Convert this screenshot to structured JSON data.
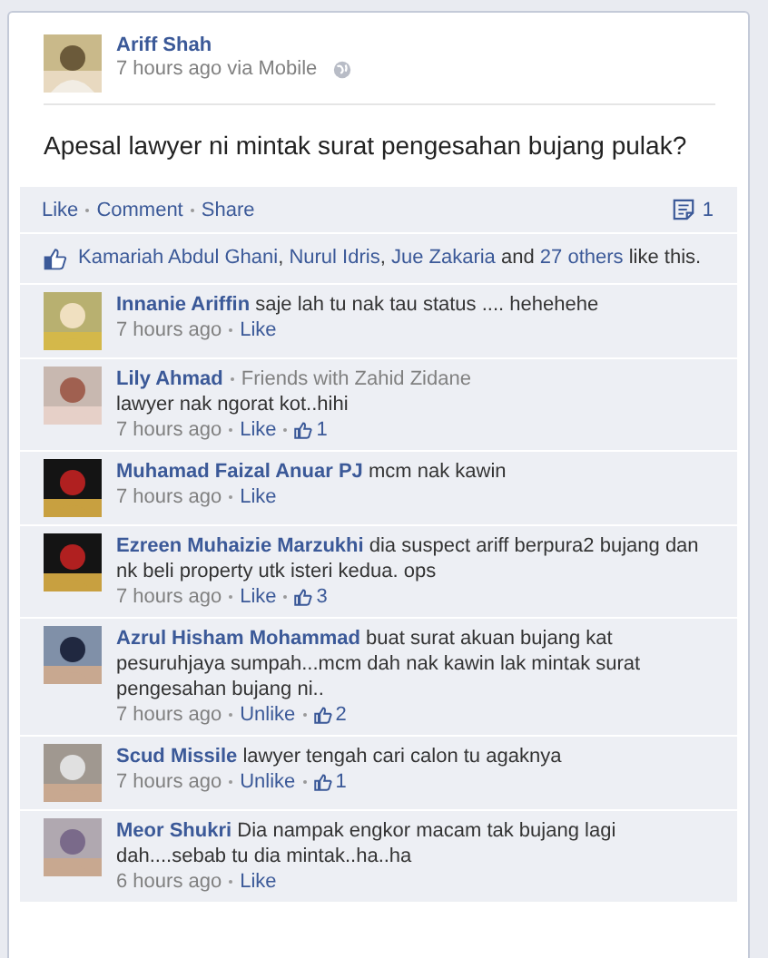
{
  "post": {
    "author": "Ariff Shah",
    "time": "7 hours ago via Mobile",
    "text": "Apesal lawyer ni mintak surat pengesahan bujang pulak?"
  },
  "actions": [
    "Like",
    "Comment",
    "Share"
  ],
  "comment_count": "1",
  "likes": {
    "parts": [
      {
        "text": "Kamariah Abdul Ghani",
        "link": true
      },
      {
        "text": ", ",
        "link": false
      },
      {
        "text": "Nurul Idris",
        "link": true
      },
      {
        "text": ", ",
        "link": false
      },
      {
        "text": "Jue Zakaria",
        "link": true
      },
      {
        "text": " and ",
        "link": false
      },
      {
        "text": "27 others",
        "link": true
      },
      {
        "text": " like this.",
        "link": false
      }
    ]
  },
  "comments": [
    {
      "author": "Innanie Ariffin",
      "text": "saje lah tu nak tau status .... hehehehe",
      "time": "7 hours ago",
      "action": "Like"
    },
    {
      "author": "Lily Ahmad",
      "subtitle": "Friends with Zahid Zidane",
      "text": "lawyer nak ngorat kot..hihi",
      "time": "7 hours ago",
      "action": "Like",
      "likes": "1"
    },
    {
      "author": "Muhamad Faizal Anuar PJ",
      "text": "mcm nak kawin",
      "time": "7 hours ago",
      "action": "Like"
    },
    {
      "author": "Ezreen Muhaizie Marzukhi",
      "text": "dia suspect ariff berpura2 bujang dan nk beli property utk isteri kedua. ops",
      "time": "7 hours ago",
      "action": "Like",
      "likes": "3"
    },
    {
      "author": "Azrul Hisham Mohammad",
      "text": "buat surat akuan bujang kat pesuruhjaya sumpah...mcm dah nak kawin lak mintak surat pengesahan bujang ni..",
      "time": "7 hours ago",
      "action": "Unlike",
      "likes": "2"
    },
    {
      "author": "Scud Missile",
      "text": "lawyer tengah cari calon tu agaknya",
      "time": "7 hours ago",
      "action": "Unlike",
      "likes": "1"
    },
    {
      "author": "Meor Shukri",
      "text": "Dia nampak engkor macam tak bujang lagi dah....sebab tu dia mintak..ha..ha",
      "time": "6 hours ago",
      "action": "Like"
    }
  ]
}
